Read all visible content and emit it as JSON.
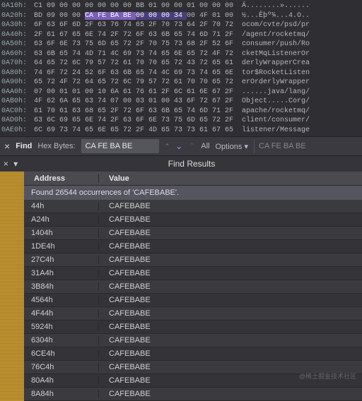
{
  "hex_view": {
    "highlight_row_index": 1,
    "highlight_cols": [
      4,
      5,
      6,
      7
    ],
    "highlight_cols2": [
      8,
      9,
      10,
      11
    ],
    "rows": [
      {
        "offset": "0A10h:",
        "bytes": [
          "C1",
          "09",
          "00",
          "00",
          "00",
          "00",
          "00",
          "00",
          "BB",
          "01",
          "00",
          "00",
          "01",
          "00",
          "00",
          "00"
        ],
        "ascii": "Á........»......"
      },
      {
        "offset": "0A20h:",
        "bytes": [
          "BD",
          "09",
          "00",
          "00",
          "CA",
          "FE",
          "BA",
          "BE",
          "00",
          "00",
          "00",
          "34",
          "00",
          "4F",
          "01",
          "00"
        ],
        "ascii": "½...Êþº¾...4.O.."
      },
      {
        "offset": "0A30h:",
        "bytes": [
          "6F",
          "63",
          "6F",
          "6D",
          "2F",
          "63",
          "76",
          "74",
          "65",
          "2F",
          "70",
          "73",
          "64",
          "2F",
          "70",
          "72"
        ],
        "ascii": "ocom/cvte/psd/pr"
      },
      {
        "offset": "0A40h:",
        "bytes": [
          "2F",
          "61",
          "67",
          "65",
          "6E",
          "74",
          "2F",
          "72",
          "6F",
          "63",
          "6B",
          "65",
          "74",
          "6D",
          "71",
          "2F"
        ],
        "ascii": "/agent/rocketmq/"
      },
      {
        "offset": "0A50h:",
        "bytes": [
          "63",
          "6F",
          "6E",
          "73",
          "75",
          "6D",
          "65",
          "72",
          "2F",
          "70",
          "75",
          "73",
          "68",
          "2F",
          "52",
          "6F"
        ],
        "ascii": "consumer/push/Ro"
      },
      {
        "offset": "0A60h:",
        "bytes": [
          "63",
          "6B",
          "65",
          "74",
          "4D",
          "71",
          "4C",
          "69",
          "73",
          "74",
          "65",
          "6E",
          "65",
          "72",
          "4F",
          "72"
        ],
        "ascii": "cketMqListenerOr"
      },
      {
        "offset": "0A70h:",
        "bytes": [
          "64",
          "65",
          "72",
          "6C",
          "79",
          "57",
          "72",
          "61",
          "70",
          "70",
          "65",
          "72",
          "43",
          "72",
          "65",
          "61"
        ],
        "ascii": "derlyWrapperCrea"
      },
      {
        "offset": "0A80h:",
        "bytes": [
          "74",
          "6F",
          "72",
          "24",
          "52",
          "6F",
          "63",
          "6B",
          "65",
          "74",
          "4C",
          "69",
          "73",
          "74",
          "65",
          "6E"
        ],
        "ascii": "tor$RocketListen"
      },
      {
        "offset": "0A90h:",
        "bytes": [
          "65",
          "72",
          "4F",
          "72",
          "64",
          "65",
          "72",
          "6C",
          "79",
          "57",
          "72",
          "61",
          "70",
          "70",
          "65",
          "72"
        ],
        "ascii": "erOrderlyWrapper"
      },
      {
        "offset": "0AA0h:",
        "bytes": [
          "07",
          "00",
          "01",
          "01",
          "00",
          "10",
          "6A",
          "61",
          "76",
          "61",
          "2F",
          "6C",
          "61",
          "6E",
          "67",
          "2F"
        ],
        "ascii": "......java/lang/"
      },
      {
        "offset": "0AB0h:",
        "bytes": [
          "4F",
          "62",
          "6A",
          "65",
          "63",
          "74",
          "07",
          "00",
          "03",
          "01",
          "00",
          "43",
          "6F",
          "72",
          "67",
          "2F"
        ],
        "ascii": "Object.....Corg/"
      },
      {
        "offset": "0AC0h:",
        "bytes": [
          "61",
          "70",
          "61",
          "63",
          "68",
          "65",
          "2F",
          "72",
          "6F",
          "63",
          "6B",
          "65",
          "74",
          "6D",
          "71",
          "2F"
        ],
        "ascii": "apache/rocketmq/"
      },
      {
        "offset": "0AD0h:",
        "bytes": [
          "63",
          "6C",
          "69",
          "65",
          "6E",
          "74",
          "2F",
          "63",
          "6F",
          "6E",
          "73",
          "75",
          "6D",
          "65",
          "72",
          "2F"
        ],
        "ascii": "client/consumer/"
      },
      {
        "offset": "0AE0h:",
        "bytes": [
          "6C",
          "69",
          "73",
          "74",
          "65",
          "6E",
          "65",
          "72",
          "2F",
          "4D",
          "65",
          "73",
          "73",
          "61",
          "67",
          "65"
        ],
        "ascii": "listener/Message"
      }
    ]
  },
  "find": {
    "label": "Find",
    "hex_bytes_label": "Hex Bytes:",
    "query": "CA FE BA BE",
    "all": "All",
    "options": "Options",
    "right_field": "CA FE BA BE"
  },
  "results": {
    "title": "Find Results",
    "col_addr": "Address",
    "col_val": "Value",
    "message": "Found 26544 occurrences of 'CAFEBABE'.",
    "rows": [
      {
        "addr": "44h",
        "val": "CAFEBABE"
      },
      {
        "addr": "A24h",
        "val": "CAFEBABE"
      },
      {
        "addr": "1404h",
        "val": "CAFEBABE"
      },
      {
        "addr": "1DE4h",
        "val": "CAFEBABE"
      },
      {
        "addr": "27C4h",
        "val": "CAFEBABE"
      },
      {
        "addr": "31A4h",
        "val": "CAFEBABE"
      },
      {
        "addr": "3B84h",
        "val": "CAFEBABE"
      },
      {
        "addr": "4564h",
        "val": "CAFEBABE"
      },
      {
        "addr": "4F44h",
        "val": "CAFEBABE"
      },
      {
        "addr": "5924h",
        "val": "CAFEBABE"
      },
      {
        "addr": "6304h",
        "val": "CAFEBABE"
      },
      {
        "addr": "6CE4h",
        "val": "CAFEBABE"
      },
      {
        "addr": "76C4h",
        "val": "CAFEBABE"
      },
      {
        "addr": "80A4h",
        "val": "CAFEBABE"
      },
      {
        "addr": "8A84h",
        "val": "CAFEBABE"
      }
    ]
  },
  "watermark": "@稀土掘金技术社区"
}
